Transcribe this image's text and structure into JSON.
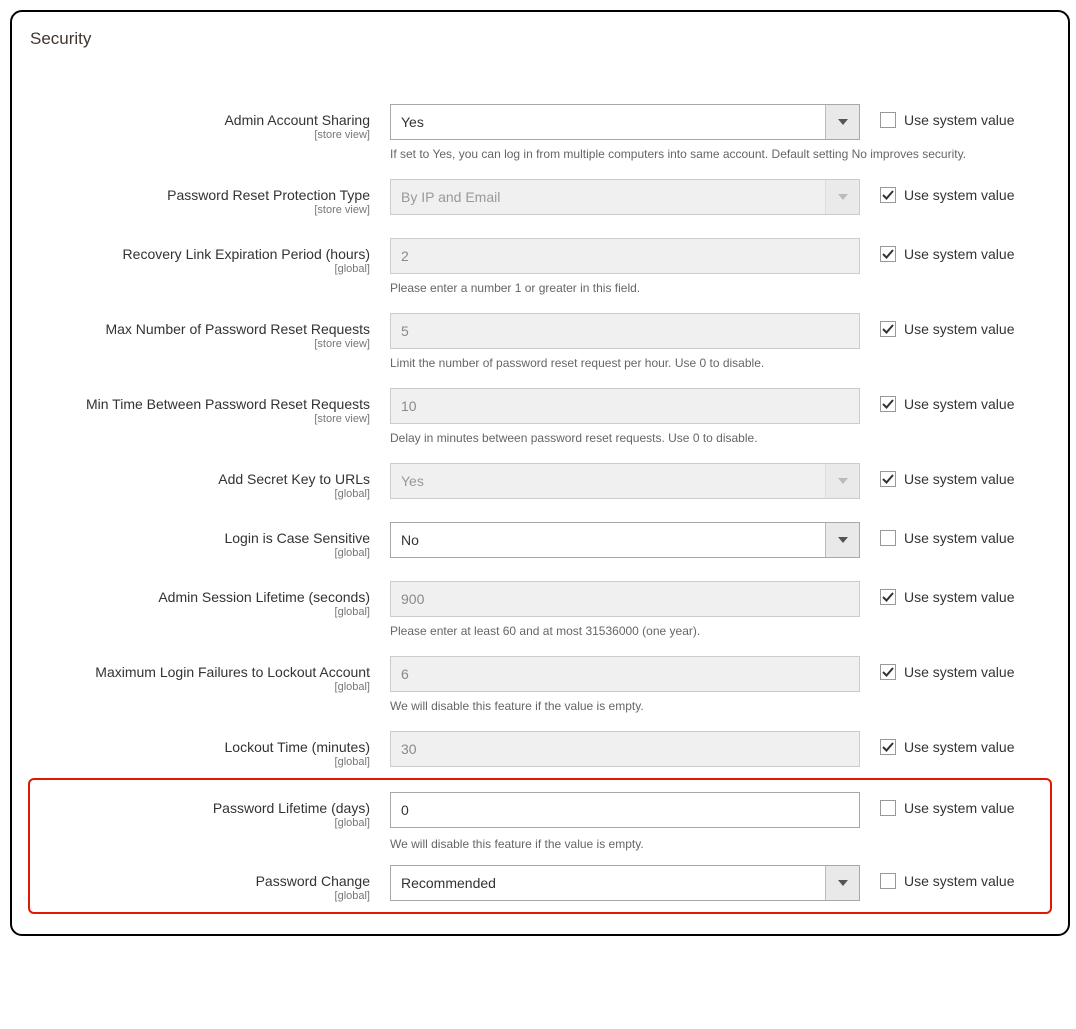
{
  "section_title": "Security",
  "use_system_value_label": "Use system value",
  "scope": {
    "store_view": "[store view]",
    "global": "[global]"
  },
  "fields": {
    "admin_sharing": {
      "label": "Admin Account Sharing",
      "scope": "store_view",
      "value": "Yes",
      "note": "If set to Yes, you can log in from multiple computers into same account. Default setting No improves security.",
      "use_system": false,
      "type": "select",
      "disabled": false
    },
    "pwd_reset_protection": {
      "label": "Password Reset Protection Type",
      "scope": "store_view",
      "value": "By IP and Email",
      "use_system": true,
      "type": "select",
      "disabled": true
    },
    "recovery_link_exp": {
      "label": "Recovery Link Expiration Period (hours)",
      "scope": "global",
      "value": "2",
      "note": "Please enter a number 1 or greater in this field.",
      "use_system": true,
      "type": "text",
      "disabled": true
    },
    "max_reset_requests": {
      "label": "Max Number of Password Reset Requests",
      "scope": "store_view",
      "value": "5",
      "note": "Limit the number of password reset request per hour. Use 0 to disable.",
      "use_system": true,
      "type": "text",
      "disabled": true
    },
    "min_time_between": {
      "label": "Min Time Between Password Reset Requests",
      "scope": "store_view",
      "value": "10",
      "note": "Delay in minutes between password reset requests. Use 0 to disable.",
      "use_system": true,
      "type": "text",
      "disabled": true
    },
    "secret_key": {
      "label": "Add Secret Key to URLs",
      "scope": "global",
      "value": "Yes",
      "use_system": true,
      "type": "select",
      "disabled": true
    },
    "login_case": {
      "label": "Login is Case Sensitive",
      "scope": "global",
      "value": "No",
      "use_system": false,
      "type": "select",
      "disabled": false
    },
    "session_lifetime": {
      "label": "Admin Session Lifetime (seconds)",
      "scope": "global",
      "value": "900",
      "note": "Please enter at least 60 and at most 31536000 (one year).",
      "use_system": true,
      "type": "text",
      "disabled": true
    },
    "max_login_failures": {
      "label": "Maximum Login Failures to Lockout Account",
      "scope": "global",
      "value": "6",
      "note": "We will disable this feature if the value is empty.",
      "use_system": true,
      "type": "text",
      "disabled": true
    },
    "lockout_time": {
      "label": "Lockout Time (minutes)",
      "scope": "global",
      "value": "30",
      "use_system": true,
      "type": "text",
      "disabled": true
    },
    "pwd_lifetime": {
      "label": "Password Lifetime (days)",
      "scope": "global",
      "value": "0",
      "note": "We will disable this feature if the value is empty.",
      "use_system": false,
      "type": "text",
      "disabled": false
    },
    "pwd_change": {
      "label": "Password Change",
      "scope": "global",
      "value": "Recommended",
      "use_system": false,
      "type": "select",
      "disabled": false
    }
  }
}
